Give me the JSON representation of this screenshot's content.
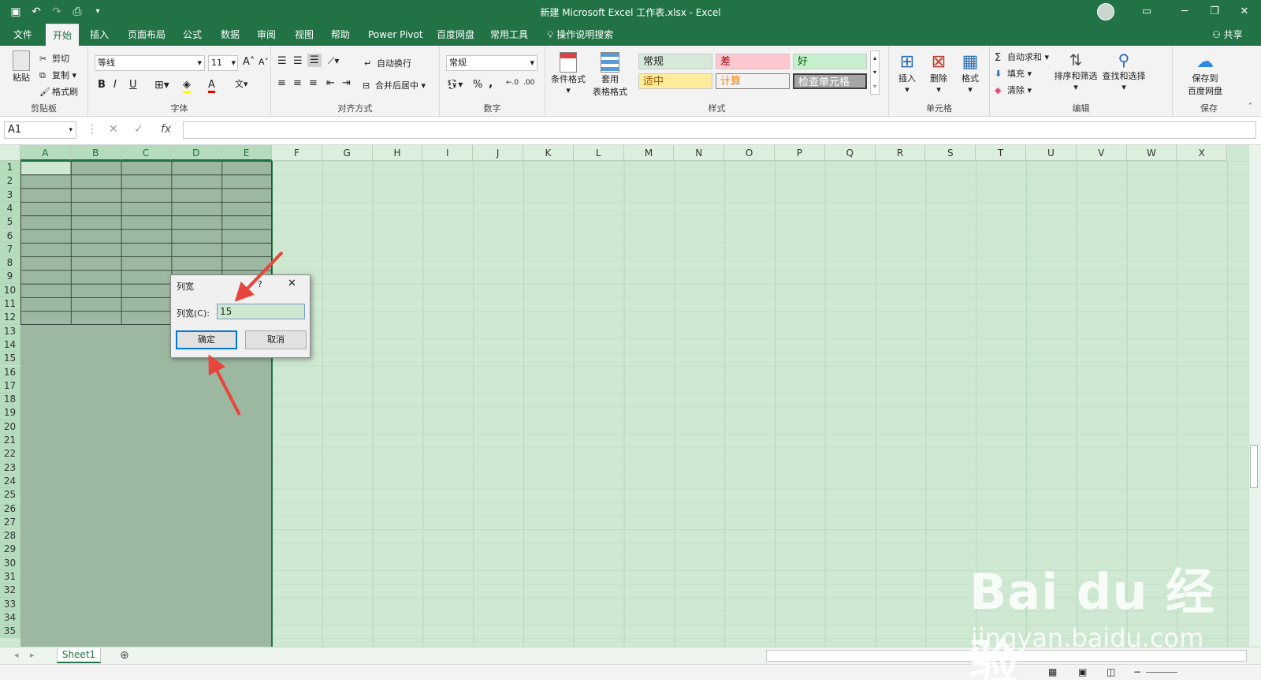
{
  "window": {
    "title": "新建 Microsoft Excel 工作表.xlsx  -  Excel"
  },
  "menu": {
    "tabs": [
      "文件",
      "开始",
      "插入",
      "页面布局",
      "公式",
      "数据",
      "审阅",
      "视图",
      "帮助",
      "Power Pivot",
      "百度网盘",
      "常用工具"
    ],
    "tell_me": "操作说明搜索",
    "share": "共享"
  },
  "ribbon": {
    "clipboard": {
      "paste": "粘贴",
      "cut": "剪切",
      "copy": "复制",
      "format_painter": "格式刷",
      "label": "剪贴板"
    },
    "font": {
      "name": "等线",
      "size": "11",
      "label": "字体",
      "bold": "B",
      "italic": "I",
      "underline": "U"
    },
    "alignment": {
      "wrap": "自动换行",
      "merge": "合并后居中",
      "label": "对齐方式"
    },
    "number": {
      "format": "常规",
      "percent": "%",
      "comma": ",",
      "label": "数字"
    },
    "styles": {
      "conditional": "条件格式",
      "table_a": "套用",
      "table_b": "表格格式",
      "label": "样式",
      "cells": [
        {
          "text": "常规",
          "bg": "#d7e9d9",
          "fg": "#222222"
        },
        {
          "text": "差",
          "bg": "#ffc7ce",
          "fg": "#9c0006"
        },
        {
          "text": "好",
          "bg": "#c6efce",
          "fg": "#006100"
        },
        {
          "text": "适中",
          "bg": "#ffeb9c",
          "fg": "#9c5700"
        },
        {
          "text": "计算",
          "bg": "#f2f2f2",
          "fg": "#fa7d00"
        },
        {
          "text": "检查单元格",
          "bg": "#a5a5a5",
          "fg": "#ffffff"
        }
      ]
    },
    "cells": {
      "insert": "插入",
      "delete": "删除",
      "format": "格式",
      "label": "单元格"
    },
    "editing": {
      "autosum": "自动求和",
      "fill": "填充",
      "clear": "清除",
      "sort": "排序和筛选",
      "find": "查找和选择",
      "label": "编辑"
    },
    "save": {
      "line1": "保存到",
      "line2": "百度网盘",
      "label": "保存"
    }
  },
  "formula": {
    "namebox": "A1",
    "fx": "fx",
    "value": ""
  },
  "sheet": {
    "columns": [
      "A",
      "B",
      "C",
      "D",
      "E",
      "F",
      "G",
      "H",
      "I",
      "J",
      "K",
      "L",
      "M",
      "N",
      "O",
      "P",
      "Q",
      "R",
      "S",
      "T",
      "U",
      "V",
      "W",
      "X"
    ],
    "rows": [
      "1",
      "2",
      "3",
      "4",
      "5",
      "6",
      "7",
      "8",
      "9",
      "10",
      "11",
      "12",
      "13",
      "14",
      "15",
      "16",
      "17",
      "18",
      "19",
      "20",
      "21",
      "22",
      "23",
      "24",
      "25",
      "26",
      "27",
      "28",
      "29",
      "30",
      "31",
      "32",
      "33",
      "34",
      "35"
    ],
    "tab": "Sheet1"
  },
  "dialog": {
    "title": "列宽",
    "help": "?",
    "label": "列宽(C):",
    "value": "15",
    "ok": "确定",
    "cancel": "取消"
  },
  "watermark": {
    "brand": "Bai du 经验",
    "url": "jingyan.baidu.com"
  }
}
